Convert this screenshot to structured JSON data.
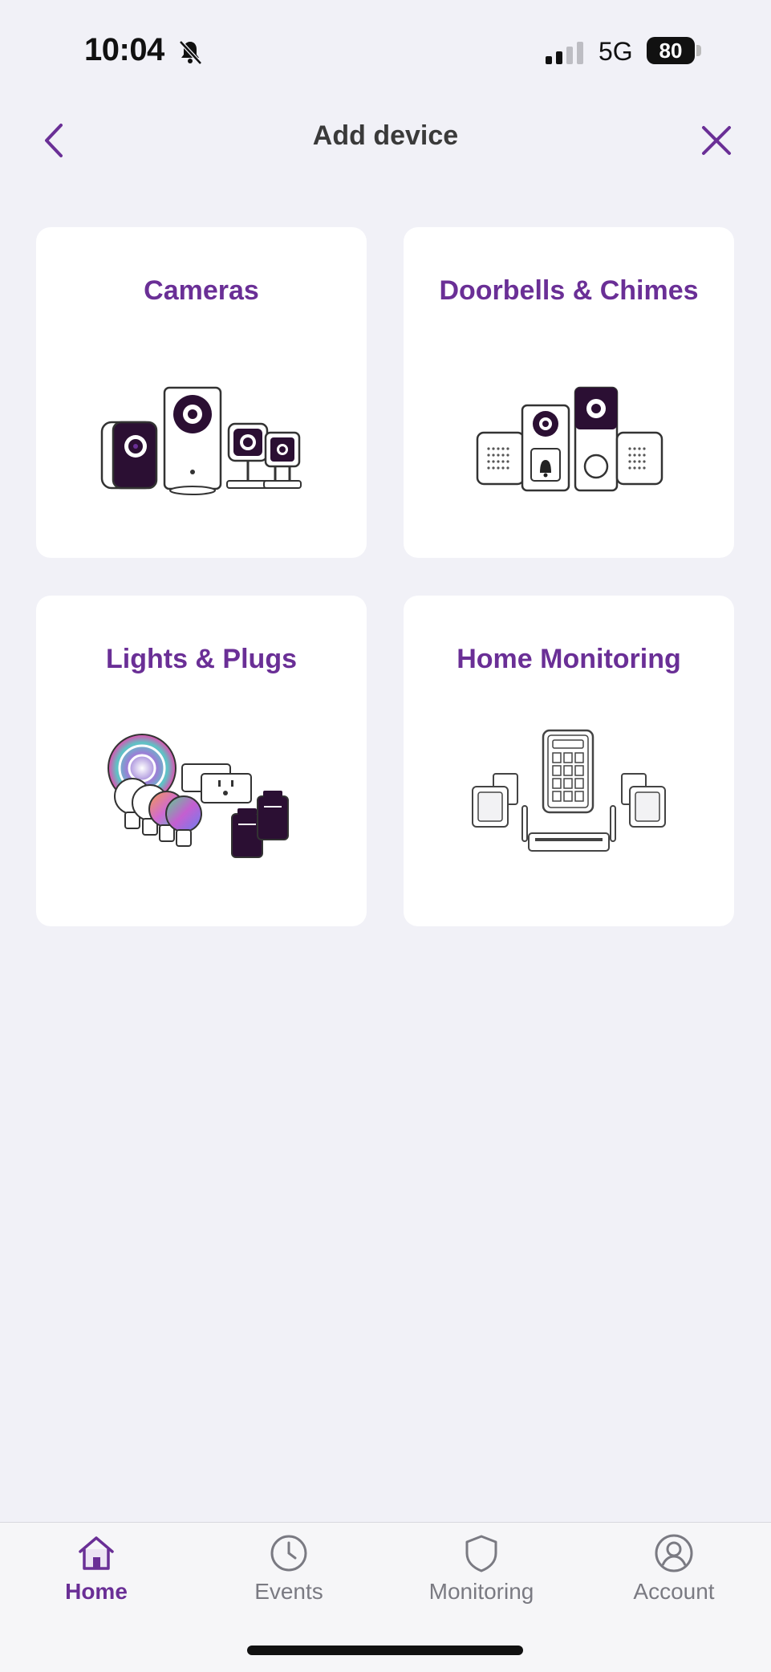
{
  "status_bar": {
    "time": "10:04",
    "network": "5G",
    "battery": "80"
  },
  "header": {
    "title": "Add device",
    "back_icon": "chevron-left-icon",
    "close_icon": "close-icon"
  },
  "categories": [
    {
      "label": "Cameras",
      "icon": "cameras-illustration"
    },
    {
      "label": "Doorbells & Chimes",
      "icon": "doorbells-chimes-illustration"
    },
    {
      "label": "Lights & Plugs",
      "icon": "lights-plugs-illustration"
    },
    {
      "label": "Home Monitoring",
      "icon": "home-monitoring-illustration"
    }
  ],
  "tabs": [
    {
      "label": "Home",
      "icon": "home-icon",
      "active": true
    },
    {
      "label": "Events",
      "icon": "clock-icon",
      "active": false
    },
    {
      "label": "Monitoring",
      "icon": "shield-icon",
      "active": false
    },
    {
      "label": "Account",
      "icon": "user-icon",
      "active": false
    }
  ],
  "colors": {
    "accent": "#6a2f96",
    "background": "#f1f1f7",
    "card": "#ffffff",
    "device_dark": "#2b0f33"
  }
}
